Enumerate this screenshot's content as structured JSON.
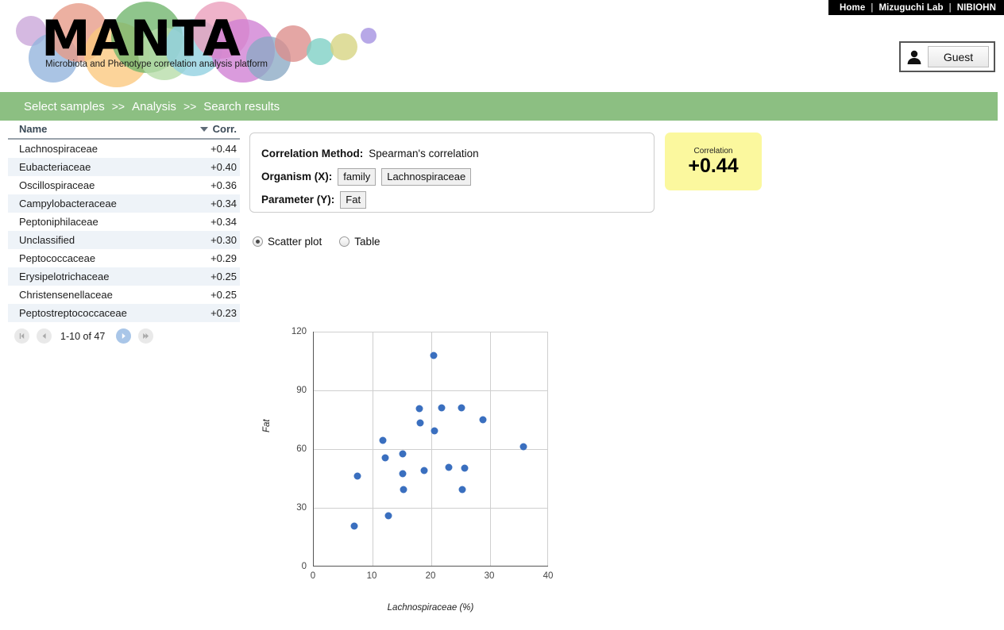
{
  "topnav": {
    "items": [
      "Home",
      "Mizuguchi Lab",
      "NIBIOHN"
    ],
    "separator": "|"
  },
  "logo": {
    "title": "MANTA",
    "subtitle": "Microbiota and Phenotype correlation analysis platform",
    "bubbles": [
      {
        "x": 6,
        "y": 18,
        "d": 38,
        "color": "#c9a5d8"
      },
      {
        "x": 22,
        "y": 40,
        "d": 62,
        "color": "#92b4dd"
      },
      {
        "x": 48,
        "y": 2,
        "d": 74,
        "color": "#e79a86"
      },
      {
        "x": 92,
        "y": 26,
        "d": 82,
        "color": "#fbc87d"
      },
      {
        "x": 126,
        "y": 0,
        "d": 90,
        "color": "#6fb56c"
      },
      {
        "x": 160,
        "y": 33,
        "d": 66,
        "color": "#b6dca8"
      },
      {
        "x": 194,
        "y": 22,
        "d": 72,
        "color": "#8fd0e0"
      },
      {
        "x": 228,
        "y": 0,
        "d": 72,
        "color": "#eb9dbb"
      },
      {
        "x": 252,
        "y": 22,
        "d": 80,
        "color": "#cf7fd4"
      },
      {
        "x": 296,
        "y": 44,
        "d": 56,
        "color": "#8aa9c4"
      },
      {
        "x": 332,
        "y": 30,
        "d": 46,
        "color": "#dd8d8a"
      },
      {
        "x": 372,
        "y": 46,
        "d": 34,
        "color": "#7ccfc4"
      },
      {
        "x": 402,
        "y": 40,
        "d": 34,
        "color": "#d6d480"
      },
      {
        "x": 440,
        "y": 33,
        "d": 20,
        "color": "#a38fe0"
      }
    ]
  },
  "account": {
    "icon": "person-icon",
    "label": "Guest"
  },
  "breadcrumb": {
    "steps": [
      "Select samples",
      "Analysis",
      "Search results"
    ],
    "arrow": ">>",
    "bar_color": "#8cbf82"
  },
  "result_table": {
    "headers": {
      "name": "Name",
      "corr": "Corr."
    },
    "sort": {
      "column": "corr",
      "direction": "desc",
      "icon": "sort-desc-icon"
    },
    "rows": [
      {
        "name": "Lachnospiraceae",
        "corr": "+0.44"
      },
      {
        "name": "Eubacteriaceae",
        "corr": "+0.40"
      },
      {
        "name": "Oscillospiraceae",
        "corr": "+0.36"
      },
      {
        "name": "Campylobacteraceae",
        "corr": "+0.34"
      },
      {
        "name": "Peptoniphilaceae",
        "corr": "+0.34"
      },
      {
        "name": "Unclassified",
        "corr": "+0.30"
      },
      {
        "name": "Peptococcaceae",
        "corr": "+0.29"
      },
      {
        "name": "Erysipelotrichaceae",
        "corr": "+0.25"
      },
      {
        "name": "Christensenellaceae",
        "corr": "+0.25"
      },
      {
        "name": "Peptostreptococcaceae",
        "corr": "+0.23"
      }
    ],
    "pager": {
      "range": "1-10 of 47",
      "first_icon": "first-page-icon",
      "prev_icon": "prev-page-icon",
      "next_icon": "next-page-icon",
      "last_icon": "last-page-icon"
    }
  },
  "info_panel": {
    "method_label": "Correlation Method:",
    "method_value": "Spearman's correlation",
    "organism_label": "Organism (X):",
    "organism_rank": "family",
    "organism_name": "Lachnospiraceae",
    "parameter_label": "Parameter (Y):",
    "parameter_value": "Fat"
  },
  "correlation_card": {
    "label": "Correlation",
    "value": "+0.44",
    "color": "#fbf89e"
  },
  "view_toggle": {
    "options": [
      {
        "label": "Scatter plot",
        "selected": true
      },
      {
        "label": "Table",
        "selected": false
      }
    ]
  },
  "chart_data": {
    "type": "scatter",
    "title": "",
    "xlabel": "Lachnospiraceae (%)",
    "ylabel": "Fat",
    "xlim": [
      0,
      40
    ],
    "ylim": [
      0,
      120
    ],
    "xticks": [
      0,
      10,
      20,
      30,
      40
    ],
    "yticks": [
      0,
      30,
      60,
      90,
      120
    ],
    "grid": true,
    "legend": "none",
    "point_color": "#3a6fbf",
    "series": [
      {
        "name": "samples",
        "points": [
          {
            "x": 6.9,
            "y": 20.5
          },
          {
            "x": 7.4,
            "y": 46.3
          },
          {
            "x": 11.8,
            "y": 64.5
          },
          {
            "x": 12.2,
            "y": 55.6
          },
          {
            "x": 12.7,
            "y": 25.8
          },
          {
            "x": 15.1,
            "y": 57.4
          },
          {
            "x": 15.2,
            "y": 47.5
          },
          {
            "x": 15.3,
            "y": 39.3
          },
          {
            "x": 18.0,
            "y": 80.6
          },
          {
            "x": 18.1,
            "y": 73.3
          },
          {
            "x": 18.8,
            "y": 49.2
          },
          {
            "x": 20.4,
            "y": 107.9
          },
          {
            "x": 20.6,
            "y": 69.5
          },
          {
            "x": 21.8,
            "y": 81.2
          },
          {
            "x": 23.0,
            "y": 50.8
          },
          {
            "x": 25.2,
            "y": 81.2
          },
          {
            "x": 25.3,
            "y": 39.3
          },
          {
            "x": 25.7,
            "y": 50.2
          },
          {
            "x": 28.8,
            "y": 75.1
          },
          {
            "x": 35.7,
            "y": 61.3
          }
        ]
      }
    ]
  }
}
